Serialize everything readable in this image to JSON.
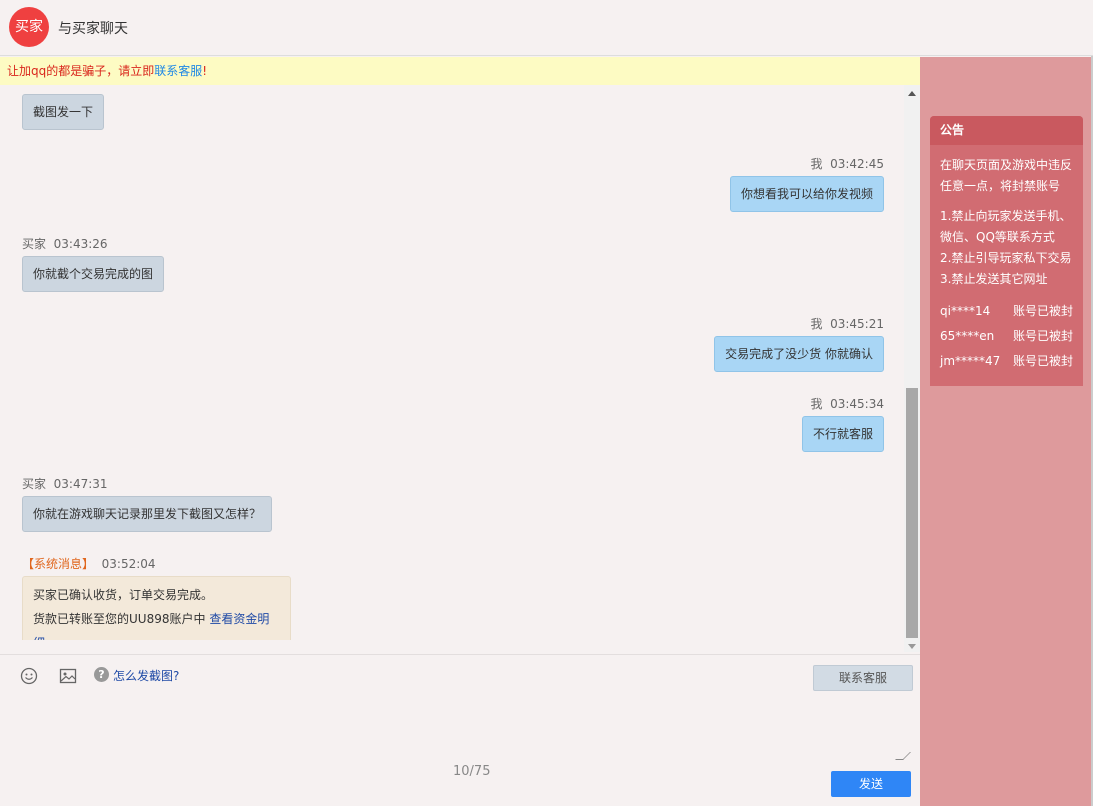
{
  "header": {
    "avatar_text": "买家",
    "title": "与买家聊天"
  },
  "warning": {
    "text": "让加qq的都是骗子，请立即",
    "link": "联系客服",
    "suffix": "!"
  },
  "messages": [
    {
      "side": "left",
      "bubble": "截图发一下"
    },
    {
      "side": "right",
      "sender": "我",
      "time": "03:42:45",
      "bubble": "你想看我可以给你发视频"
    },
    {
      "side": "left",
      "sender": "买家",
      "time": "03:43:26",
      "bubble": "你就截个交易完成的图"
    },
    {
      "side": "right",
      "sender": "我",
      "time": "03:45:21",
      "bubble": "交易完成了没少货 你就确认"
    },
    {
      "side": "right",
      "sender": "我",
      "time": "03:45:34",
      "bubble": "不行就客服"
    },
    {
      "side": "left",
      "sender": "买家",
      "time": "03:47:31",
      "bubble": "你就在游戏聊天记录那里发下截图又怎样？"
    }
  ],
  "system_message": {
    "tag": "【系统消息】",
    "time": "03:52:04",
    "line1": "买家已确认收货，订单交易完成。",
    "line2": "货款已转账至您的UU898账户中",
    "link": "查看资金明细"
  },
  "toolbar": {
    "help_link": "怎么发截图?",
    "service_button": "联系客服",
    "help_icon_text": "?"
  },
  "input": {
    "counter": "10/75",
    "send_button": "发送"
  },
  "notice": {
    "title": "公告",
    "intro": "在聊天页面及游戏中违反任意一点，将封禁账号",
    "rules": [
      "1.禁止向玩家发送手机、微信、QQ等联系方式",
      "2.禁止引导玩家私下交易",
      "3.禁止发送其它网址"
    ],
    "banned": [
      {
        "account": "qi****14",
        "status": "账号已被封"
      },
      {
        "account": "65****en",
        "status": "账号已被封"
      },
      {
        "account": "jm*****47",
        "status": "账号已被封"
      }
    ]
  }
}
